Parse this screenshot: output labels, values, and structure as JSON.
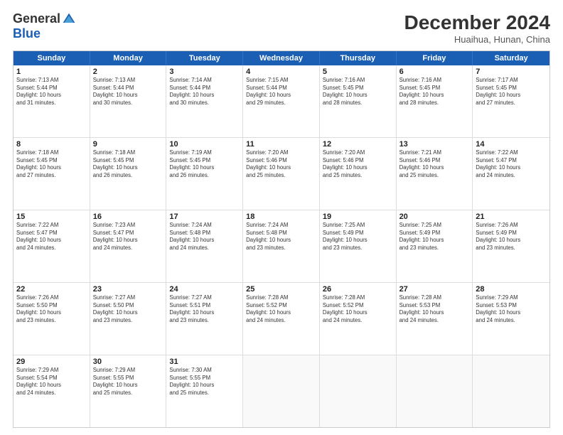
{
  "logo": {
    "general": "General",
    "blue": "Blue"
  },
  "header": {
    "month": "December 2024",
    "location": "Huaihua, Hunan, China"
  },
  "days": [
    "Sunday",
    "Monday",
    "Tuesday",
    "Wednesday",
    "Thursday",
    "Friday",
    "Saturday"
  ],
  "weeks": [
    [
      {
        "day": "1",
        "info": "Sunrise: 7:13 AM\nSunset: 5:44 PM\nDaylight: 10 hours\nand 31 minutes."
      },
      {
        "day": "2",
        "info": "Sunrise: 7:13 AM\nSunset: 5:44 PM\nDaylight: 10 hours\nand 30 minutes."
      },
      {
        "day": "3",
        "info": "Sunrise: 7:14 AM\nSunset: 5:44 PM\nDaylight: 10 hours\nand 30 minutes."
      },
      {
        "day": "4",
        "info": "Sunrise: 7:15 AM\nSunset: 5:44 PM\nDaylight: 10 hours\nand 29 minutes."
      },
      {
        "day": "5",
        "info": "Sunrise: 7:16 AM\nSunset: 5:45 PM\nDaylight: 10 hours\nand 28 minutes."
      },
      {
        "day": "6",
        "info": "Sunrise: 7:16 AM\nSunset: 5:45 PM\nDaylight: 10 hours\nand 28 minutes."
      },
      {
        "day": "7",
        "info": "Sunrise: 7:17 AM\nSunset: 5:45 PM\nDaylight: 10 hours\nand 27 minutes."
      }
    ],
    [
      {
        "day": "8",
        "info": "Sunrise: 7:18 AM\nSunset: 5:45 PM\nDaylight: 10 hours\nand 27 minutes."
      },
      {
        "day": "9",
        "info": "Sunrise: 7:18 AM\nSunset: 5:45 PM\nDaylight: 10 hours\nand 26 minutes."
      },
      {
        "day": "10",
        "info": "Sunrise: 7:19 AM\nSunset: 5:45 PM\nDaylight: 10 hours\nand 26 minutes."
      },
      {
        "day": "11",
        "info": "Sunrise: 7:20 AM\nSunset: 5:46 PM\nDaylight: 10 hours\nand 25 minutes."
      },
      {
        "day": "12",
        "info": "Sunrise: 7:20 AM\nSunset: 5:46 PM\nDaylight: 10 hours\nand 25 minutes."
      },
      {
        "day": "13",
        "info": "Sunrise: 7:21 AM\nSunset: 5:46 PM\nDaylight: 10 hours\nand 25 minutes."
      },
      {
        "day": "14",
        "info": "Sunrise: 7:22 AM\nSunset: 5:47 PM\nDaylight: 10 hours\nand 24 minutes."
      }
    ],
    [
      {
        "day": "15",
        "info": "Sunrise: 7:22 AM\nSunset: 5:47 PM\nDaylight: 10 hours\nand 24 minutes."
      },
      {
        "day": "16",
        "info": "Sunrise: 7:23 AM\nSunset: 5:47 PM\nDaylight: 10 hours\nand 24 minutes."
      },
      {
        "day": "17",
        "info": "Sunrise: 7:24 AM\nSunset: 5:48 PM\nDaylight: 10 hours\nand 24 minutes."
      },
      {
        "day": "18",
        "info": "Sunrise: 7:24 AM\nSunset: 5:48 PM\nDaylight: 10 hours\nand 23 minutes."
      },
      {
        "day": "19",
        "info": "Sunrise: 7:25 AM\nSunset: 5:49 PM\nDaylight: 10 hours\nand 23 minutes."
      },
      {
        "day": "20",
        "info": "Sunrise: 7:25 AM\nSunset: 5:49 PM\nDaylight: 10 hours\nand 23 minutes."
      },
      {
        "day": "21",
        "info": "Sunrise: 7:26 AM\nSunset: 5:49 PM\nDaylight: 10 hours\nand 23 minutes."
      }
    ],
    [
      {
        "day": "22",
        "info": "Sunrise: 7:26 AM\nSunset: 5:50 PM\nDaylight: 10 hours\nand 23 minutes."
      },
      {
        "day": "23",
        "info": "Sunrise: 7:27 AM\nSunset: 5:50 PM\nDaylight: 10 hours\nand 23 minutes."
      },
      {
        "day": "24",
        "info": "Sunrise: 7:27 AM\nSunset: 5:51 PM\nDaylight: 10 hours\nand 23 minutes."
      },
      {
        "day": "25",
        "info": "Sunrise: 7:28 AM\nSunset: 5:52 PM\nDaylight: 10 hours\nand 24 minutes."
      },
      {
        "day": "26",
        "info": "Sunrise: 7:28 AM\nSunset: 5:52 PM\nDaylight: 10 hours\nand 24 minutes."
      },
      {
        "day": "27",
        "info": "Sunrise: 7:28 AM\nSunset: 5:53 PM\nDaylight: 10 hours\nand 24 minutes."
      },
      {
        "day": "28",
        "info": "Sunrise: 7:29 AM\nSunset: 5:53 PM\nDaylight: 10 hours\nand 24 minutes."
      }
    ],
    [
      {
        "day": "29",
        "info": "Sunrise: 7:29 AM\nSunset: 5:54 PM\nDaylight: 10 hours\nand 24 minutes."
      },
      {
        "day": "30",
        "info": "Sunrise: 7:29 AM\nSunset: 5:55 PM\nDaylight: 10 hours\nand 25 minutes."
      },
      {
        "day": "31",
        "info": "Sunrise: 7:30 AM\nSunset: 5:55 PM\nDaylight: 10 hours\nand 25 minutes."
      },
      {
        "day": "",
        "info": ""
      },
      {
        "day": "",
        "info": ""
      },
      {
        "day": "",
        "info": ""
      },
      {
        "day": "",
        "info": ""
      }
    ]
  ]
}
